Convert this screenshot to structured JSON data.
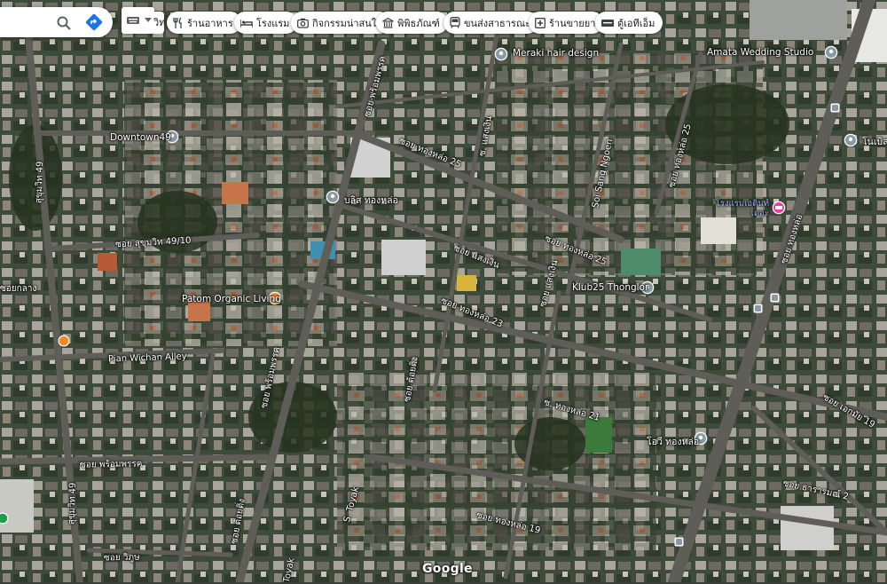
{
  "toolbar": {
    "search": {
      "icon": "search-icon",
      "directions_icon": "directions-icon"
    },
    "layer": {
      "icon": "keyboard-icon",
      "dropdown_icon": "caret-down-icon"
    },
    "cut_label": "วิท",
    "categories": [
      {
        "label": "ร้านอาหาร",
        "icon": "restaurant-icon"
      },
      {
        "label": "โรงแรม",
        "icon": "hotel-icon"
      },
      {
        "label": "กิจกรรมน่าสนใจ",
        "icon": "camera-icon"
      },
      {
        "label": "พิพิธภัณฑ์",
        "icon": "museum-icon"
      },
      {
        "label": "ขนส่งสาธารณะ",
        "icon": "transit-icon"
      },
      {
        "label": "ร้านขายยา",
        "icon": "pharmacy-icon"
      },
      {
        "label": "ตู้เอทีเอ็ม",
        "icon": "atm-icon"
      }
    ]
  },
  "places": [
    {
      "name": "Meraki hair design",
      "color": "#8a9aa3"
    },
    {
      "name": "Amata Wedding Studio",
      "color": "#8a9aa3"
    },
    {
      "name": "Downtown49",
      "color": "#8a9aa3"
    },
    {
      "name": "โนเบิล",
      "color": "#8a9aa3"
    },
    {
      "name": "บลิส ทองหล่อ",
      "color": "#8a9aa3"
    },
    {
      "name": "โรงแรมเอดินท์เดอะ",
      "color": "#e43fa4"
    },
    {
      "name": "Patom Organic Living",
      "color": "#f08a26"
    },
    {
      "name": "Klub25 Thonglor",
      "color": "#8a9aa3"
    },
    {
      "name": "โอวี ทองหล่อ",
      "color": "#8a9aa3"
    }
  ],
  "roads": [
    "ซอย พร้อมพรรค",
    "ซอย ทองหล่อ 25",
    "ซ. แสงเงิน",
    "Soi Sang Ngoen",
    "ซอย ทองหล่อ 25",
    "ซอย สุขุมวิท 49/10",
    "ซอย แสงเงิน",
    "ซอย ทองหล่อ 25",
    "ซอย แสงเงิน",
    "ซอย ทองหล่อ 23",
    "สุขุมวิท 49",
    "ซอยกลาง",
    "Pian Wichan Alley",
    "ซอย ทองหล่อ",
    "ซอย พร้อมพรรค",
    "ซอย ต้อยติ่ง",
    "ซ. ทองหล่อ 21",
    "ซอย เอกมัย 19",
    "ซอย พร้อมพรรค",
    "ซอย ธารารมณ์ 2",
    "S. Toyak",
    "ซอย ทองหล่อ 19",
    "ซอย ต้อยติ่ง",
    "ซอย วิภูษ",
    "สุขุมวิท 49",
    "Toyak"
  ],
  "small_pins": [
    {
      "name": "orange-poi",
      "color": "#f08a26"
    },
    {
      "name": "green-poi",
      "color": "#1e9d4a"
    },
    {
      "name": "transit-stop",
      "color": "#8a9aa3"
    }
  ],
  "branding": {
    "logo": "Google"
  }
}
